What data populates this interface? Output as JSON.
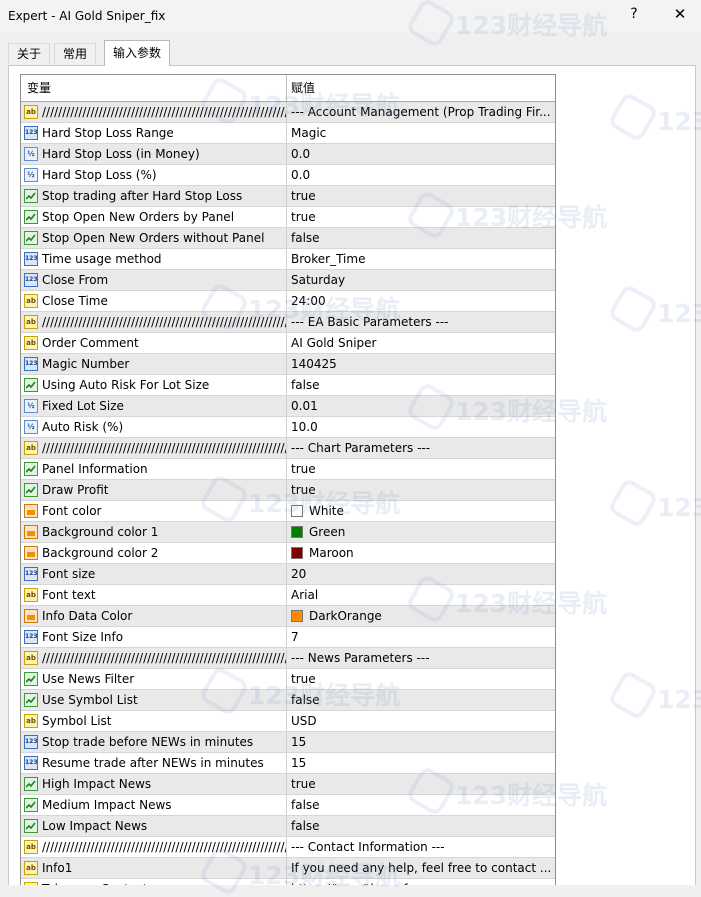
{
  "window": {
    "title": "Expert - AI Gold Sniper_fix",
    "help_glyph": "?",
    "close_glyph": "✕"
  },
  "tabs": [
    "关于",
    "常用",
    "输入参数"
  ],
  "active_tab": "输入参数",
  "table": {
    "headers": {
      "variable": "变量",
      "value": "赋值"
    },
    "rows": [
      {
        "type": "string",
        "name": "/////////////////////////////////////////////////////////////",
        "value": "--- Account Management (Prop Trading Fir..."
      },
      {
        "type": "int",
        "name": "Hard Stop Loss Range",
        "value": "Magic"
      },
      {
        "type": "double",
        "name": "Hard Stop Loss (in Money)",
        "value": "0.0"
      },
      {
        "type": "double",
        "name": "Hard Stop Loss (%)",
        "value": "0.0"
      },
      {
        "type": "bool",
        "name": "Stop trading after Hard Stop Loss",
        "value": "true"
      },
      {
        "type": "bool",
        "name": "Stop Open New Orders by Panel",
        "value": "true"
      },
      {
        "type": "bool",
        "name": "Stop Open New Orders without Panel",
        "value": "false"
      },
      {
        "type": "int",
        "name": "Time usage method",
        "value": "Broker_Time"
      },
      {
        "type": "int",
        "name": "Close From",
        "value": "Saturday"
      },
      {
        "type": "string",
        "name": "Close Time",
        "value": "24:00"
      },
      {
        "type": "string",
        "name": "/////////////////////////////////////////////////////////////",
        "value": "--- EA Basic Parameters ---"
      },
      {
        "type": "string",
        "name": "Order Comment",
        "value": "AI Gold Sniper"
      },
      {
        "type": "int",
        "name": "Magic Number",
        "value": "140425"
      },
      {
        "type": "bool",
        "name": "Using Auto Risk For Lot Size",
        "value": "false"
      },
      {
        "type": "double",
        "name": "Fixed Lot Size",
        "value": "0.01"
      },
      {
        "type": "double",
        "name": "Auto Risk (%)",
        "value": "10.0"
      },
      {
        "type": "string",
        "name": "/////////////////////////////////////////////////////////////",
        "value": "--- Chart Parameters ---"
      },
      {
        "type": "bool",
        "name": "Panel Information",
        "value": "true"
      },
      {
        "type": "bool",
        "name": "Draw Profit",
        "value": "true"
      },
      {
        "type": "color",
        "name": "Font color",
        "value": "White",
        "swatch": "#ffffff"
      },
      {
        "type": "color",
        "name": "Background color 1",
        "value": "Green",
        "swatch": "#008000"
      },
      {
        "type": "color",
        "name": "Background color 2",
        "value": "Maroon",
        "swatch": "#800000"
      },
      {
        "type": "int",
        "name": "Font size",
        "value": "20"
      },
      {
        "type": "string",
        "name": "Font text",
        "value": "Arial"
      },
      {
        "type": "color",
        "name": "Info Data Color",
        "value": "DarkOrange",
        "swatch": "#ff8c00"
      },
      {
        "type": "int",
        "name": "Font Size Info",
        "value": "7"
      },
      {
        "type": "string",
        "name": "/////////////////////////////////////////////////////////////",
        "value": "--- News Parameters ---"
      },
      {
        "type": "bool",
        "name": "Use News Filter",
        "value": "true"
      },
      {
        "type": "bool",
        "name": "Use Symbol List",
        "value": "false"
      },
      {
        "type": "string",
        "name": "Symbol List",
        "value": "USD"
      },
      {
        "type": "int",
        "name": "Stop trade before NEWs in minutes",
        "value": "15"
      },
      {
        "type": "int",
        "name": "Resume trade after NEWs in minutes",
        "value": "15"
      },
      {
        "type": "bool",
        "name": "High Impact News",
        "value": "true"
      },
      {
        "type": "bool",
        "name": "Medium Impact News",
        "value": "false"
      },
      {
        "type": "bool",
        "name": "Low Impact News",
        "value": "false"
      },
      {
        "type": "string",
        "name": "/////////////////////////////////////////////////////////////",
        "value": "--- Contact Information ---"
      },
      {
        "type": "string",
        "name": "Info1",
        "value": "If you need any help, feel free to contact ..."
      },
      {
        "type": "string",
        "name": "Telegram Contact",
        "value": "https://t.me/the_ref"
      }
    ]
  },
  "watermark_text": "123财经导航",
  "colors": {
    "row_alt": "#e9e9e9",
    "grid_border": "#8e8e8e"
  }
}
